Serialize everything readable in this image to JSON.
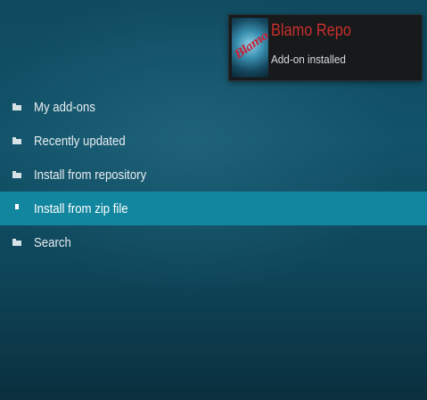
{
  "notification": {
    "thumbnail_text": "Blamo",
    "title": "Blamo Repo",
    "message": "Add-on installed"
  },
  "menu": {
    "items": [
      {
        "label": "My add-ons",
        "icon": "folder-icon",
        "selected": false
      },
      {
        "label": "Recently updated",
        "icon": "folder-icon",
        "selected": false
      },
      {
        "label": "Install from repository",
        "icon": "folder-icon",
        "selected": false
      },
      {
        "label": "Install from zip file",
        "icon": "file-icon",
        "selected": true
      },
      {
        "label": "Search",
        "icon": "folder-icon",
        "selected": false
      }
    ]
  },
  "colors": {
    "background": "#12536a",
    "selected_row": "#12869f",
    "notification_title": "#c9302c",
    "notification_bg": "#17191b"
  }
}
